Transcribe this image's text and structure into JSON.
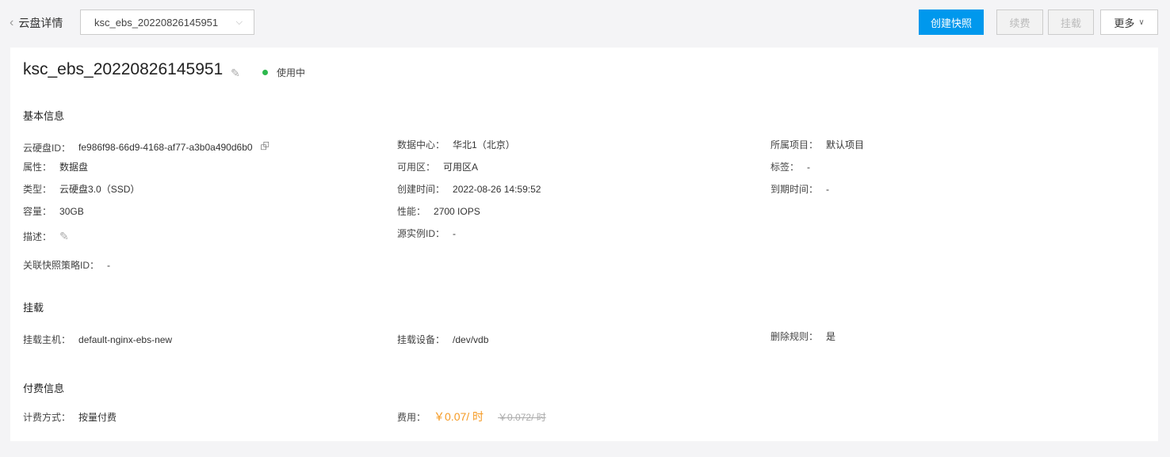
{
  "header": {
    "back_label": "云盘详情",
    "selected_disk": "ksc_ebs_20220826145951",
    "buttons": {
      "create_snapshot": "创建快照",
      "renew": "续费",
      "attach": "挂载",
      "more": "更多"
    }
  },
  "disk": {
    "name": "ksc_ebs_20220826145951",
    "status": "使用中",
    "status_color": "#2db84d"
  },
  "basic": {
    "title": "基本信息",
    "disk_id": {
      "label": "云硬盘ID：",
      "value": "fe986f98-66d9-4168-af77-a3b0a490d6b0"
    },
    "attribute": {
      "label": "属性：",
      "value": "数据盘"
    },
    "type": {
      "label": "类型：",
      "value": "云硬盘3.0（SSD）"
    },
    "capacity": {
      "label": "容量：",
      "value": "30GB"
    },
    "description": {
      "label": "描述："
    },
    "snapshot_policy": {
      "label": "关联快照策略ID：",
      "value": "-"
    },
    "datacenter": {
      "label": "数据中心：",
      "value": "华北1（北京）"
    },
    "zone": {
      "label": "可用区：",
      "value": "可用区A"
    },
    "created": {
      "label": "创建时间：",
      "value": "2022-08-26 14:59:52"
    },
    "performance": {
      "label": "性能：",
      "value": "2700 IOPS"
    },
    "source_instance": {
      "label": "源实例ID：",
      "value": "-"
    },
    "project": {
      "label": "所属项目：",
      "value": "默认项目"
    },
    "tags": {
      "label": "标签：",
      "value": "-"
    },
    "expiry": {
      "label": "到期时间：",
      "value": "-"
    }
  },
  "mount": {
    "title": "挂载",
    "host": {
      "label": "挂载主机：",
      "value": "default-nginx-ebs-new"
    },
    "device": {
      "label": "挂载设备：",
      "value": "/dev/vdb"
    },
    "delete_rule": {
      "label": "删除规则：",
      "value": "是"
    }
  },
  "billing": {
    "title": "付费信息",
    "method": {
      "label": "计费方式：",
      "value": "按量付费"
    },
    "fee": {
      "label": "费用：",
      "price": "￥0.07/ 时",
      "original": "￥0.072/ 时"
    }
  }
}
